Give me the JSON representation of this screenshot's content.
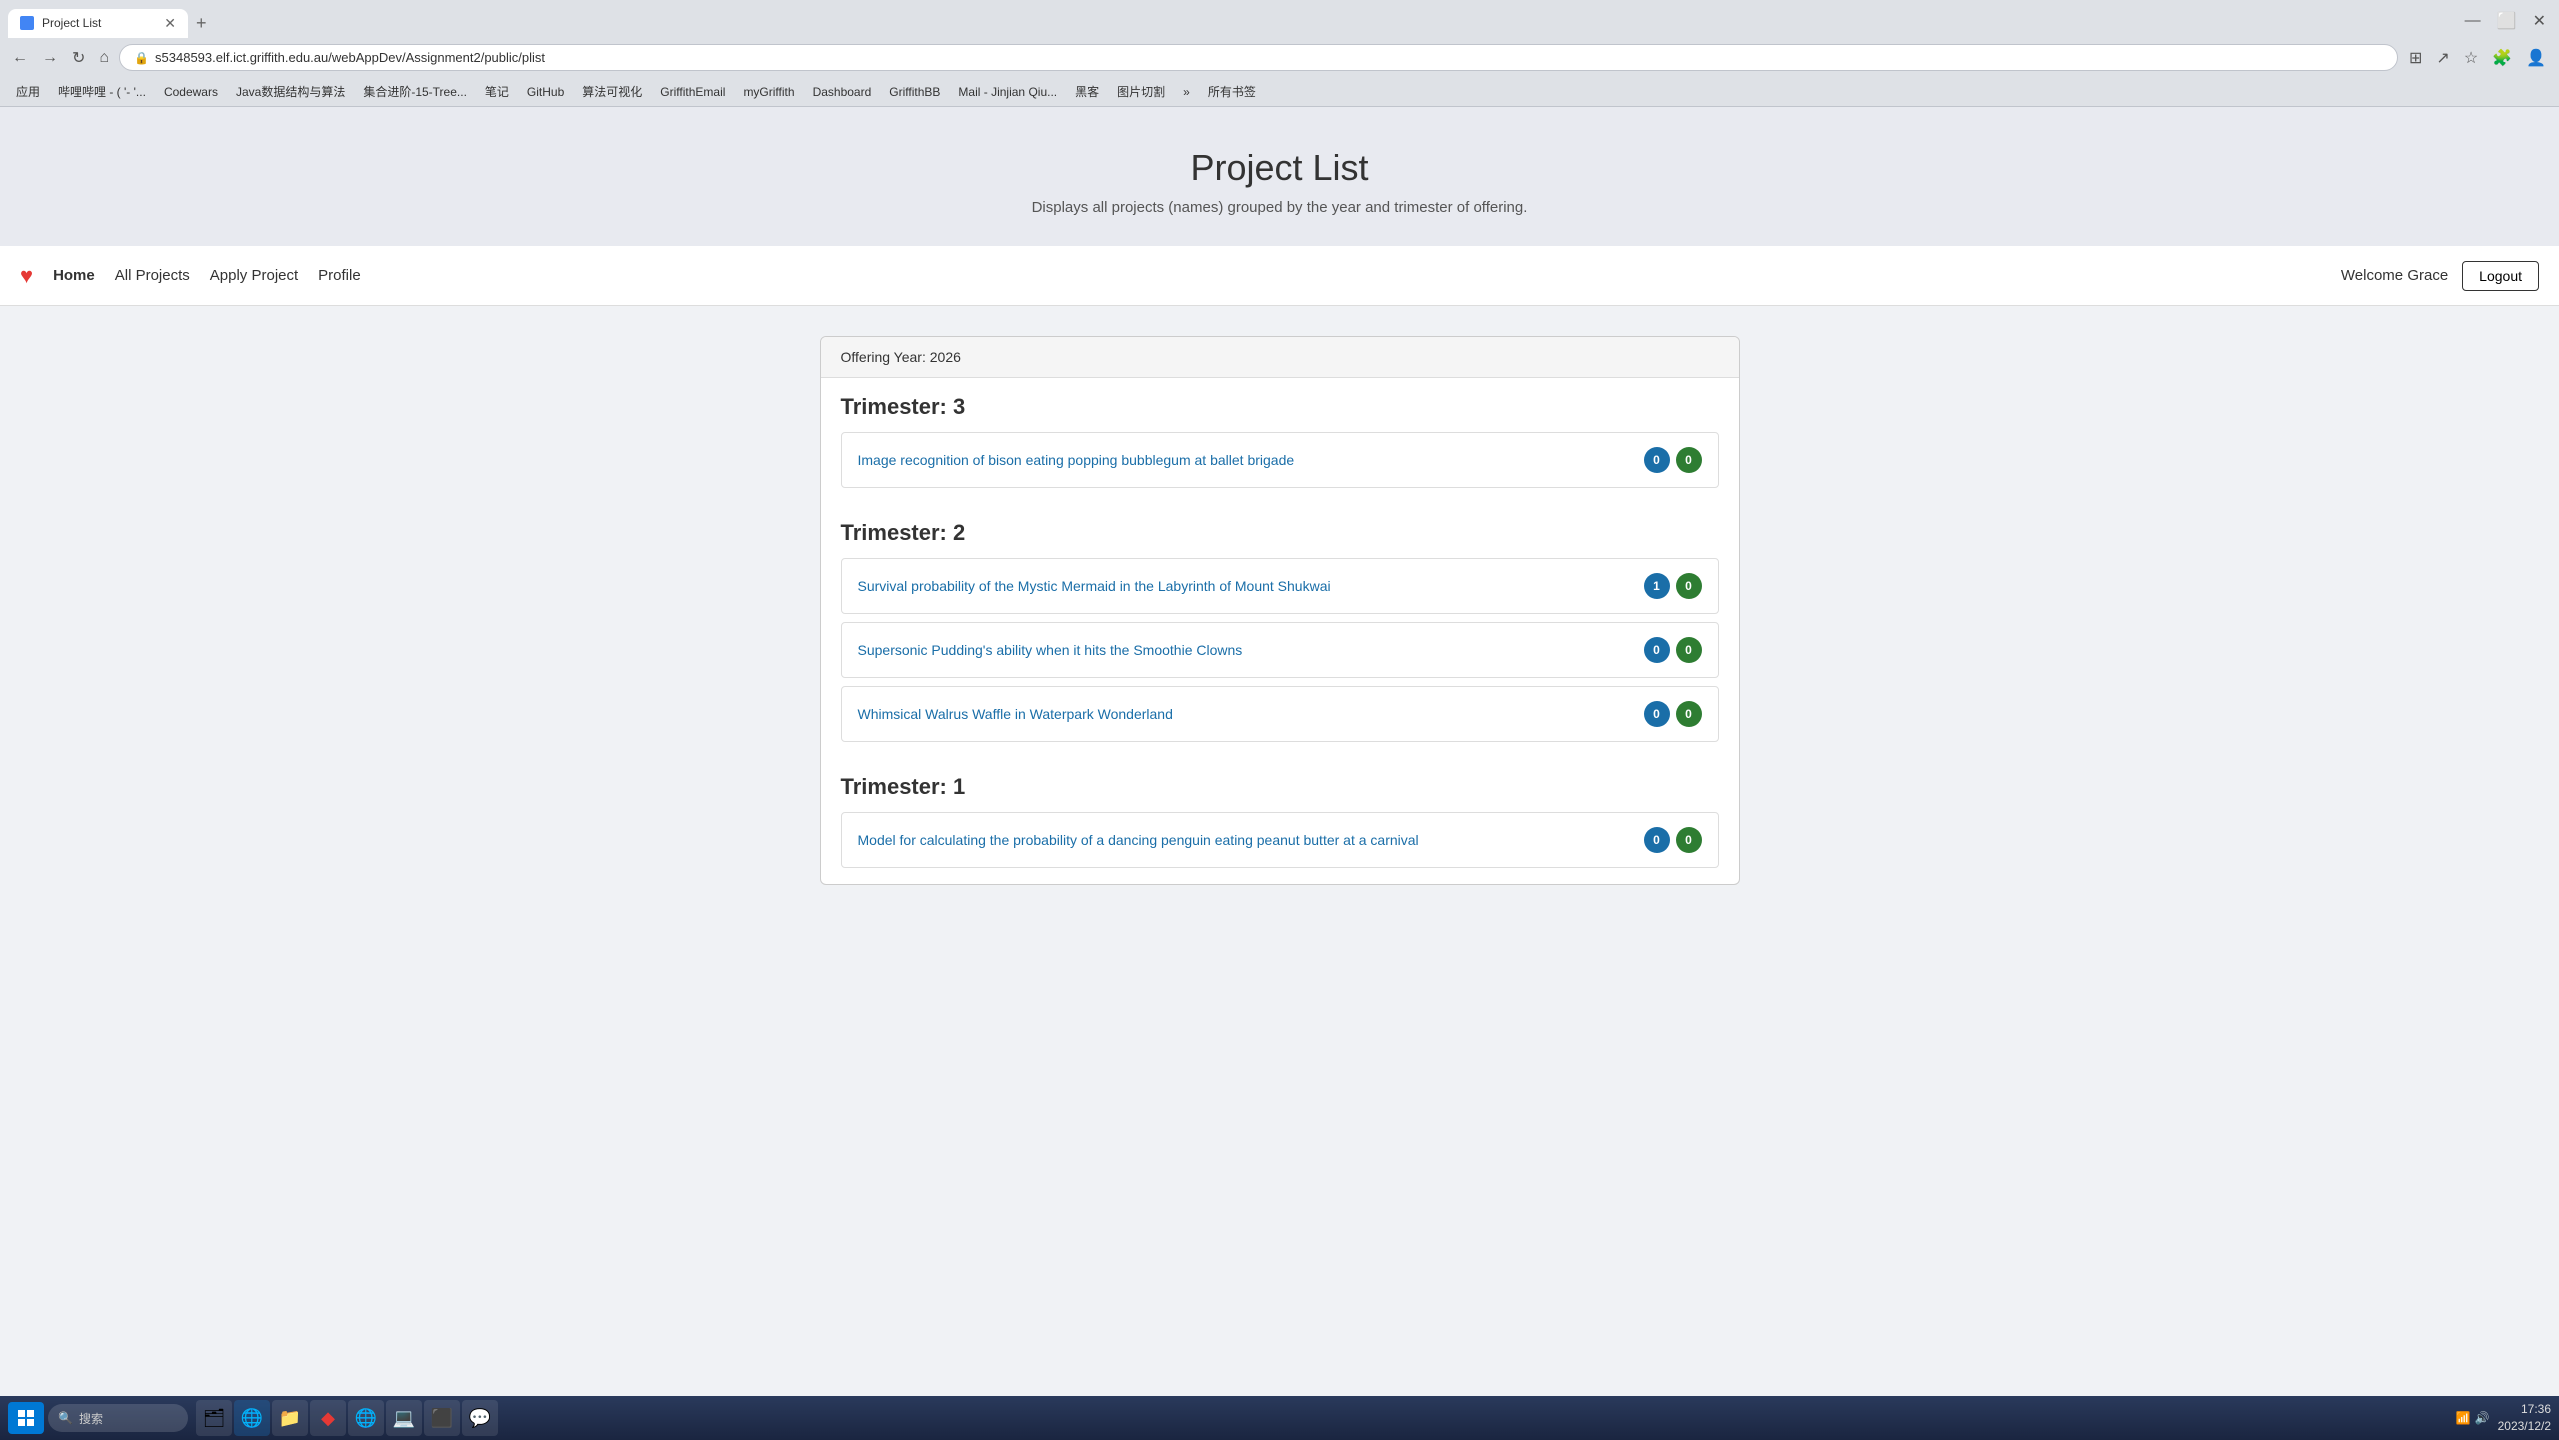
{
  "browser": {
    "tab_title": "Project List",
    "url": "s5348593.elf.ict.griffith.edu.au/webAppDev/Assignment2/public/plist",
    "new_tab_label": "+",
    "nav_back": "←",
    "nav_forward": "→",
    "nav_refresh": "↻",
    "bookmarks": [
      {
        "label": "应用"
      },
      {
        "label": "哔哩哔哩 - ( '- '..."
      },
      {
        "label": "Codewars"
      },
      {
        "label": "Java数据结构与算法"
      },
      {
        "label": "集合进阶-15-Tree..."
      },
      {
        "label": "笔记"
      },
      {
        "label": "GitHub"
      },
      {
        "label": "算法可视化"
      },
      {
        "label": "GriffithEmail"
      },
      {
        "label": "myGriffith"
      },
      {
        "label": "Dashboard"
      },
      {
        "label": "GriffithBB"
      },
      {
        "label": "Mail - Jinjian Qiu..."
      },
      {
        "label": "黑客"
      },
      {
        "label": "图片切割"
      },
      {
        "label": "»"
      },
      {
        "label": "所有书签"
      }
    ]
  },
  "page": {
    "title": "Project List",
    "subtitle": "Displays all projects (names) grouped by the year and trimester of offering."
  },
  "navbar": {
    "brand_icon": "♥",
    "links": [
      {
        "label": "Home",
        "active": true
      },
      {
        "label": "All Projects"
      },
      {
        "label": "Apply Project"
      },
      {
        "label": "Profile"
      }
    ],
    "welcome_text": "Welcome Grace",
    "logout_label": "Logout"
  },
  "content": {
    "offering_year_label": "Offering Year: 2026",
    "trimesters": [
      {
        "title": "Trimester: 3",
        "projects": [
          {
            "name": "Image recognition of bison eating popping bubblegum at ballet brigade",
            "badge_blue": "0",
            "badge_green": "0"
          }
        ]
      },
      {
        "title": "Trimester: 2",
        "projects": [
          {
            "name": "Survival probability of the Mystic Mermaid in the Labyrinth of Mount Shukwai",
            "badge_blue": "1",
            "badge_green": "0"
          },
          {
            "name": "Supersonic Pudding's ability when it hits the Smoothie Clowns",
            "badge_blue": "0",
            "badge_green": "0"
          },
          {
            "name": "Whimsical Walrus Waffle in Waterpark Wonderland",
            "badge_blue": "0",
            "badge_green": "0"
          }
        ]
      },
      {
        "title": "Trimester: 1",
        "projects": [
          {
            "name": "Model for calculating the probability of a dancing penguin eating peanut butter at a carnival",
            "badge_blue": "0",
            "badge_green": "0"
          }
        ]
      }
    ]
  },
  "taskbar": {
    "search_placeholder": "搜索",
    "time": "17:36",
    "date": "2023/12/2",
    "apps": [
      "🗂",
      "🔍",
      "📁",
      "◆",
      "🌐",
      "🔷",
      "💻",
      "💬"
    ]
  }
}
